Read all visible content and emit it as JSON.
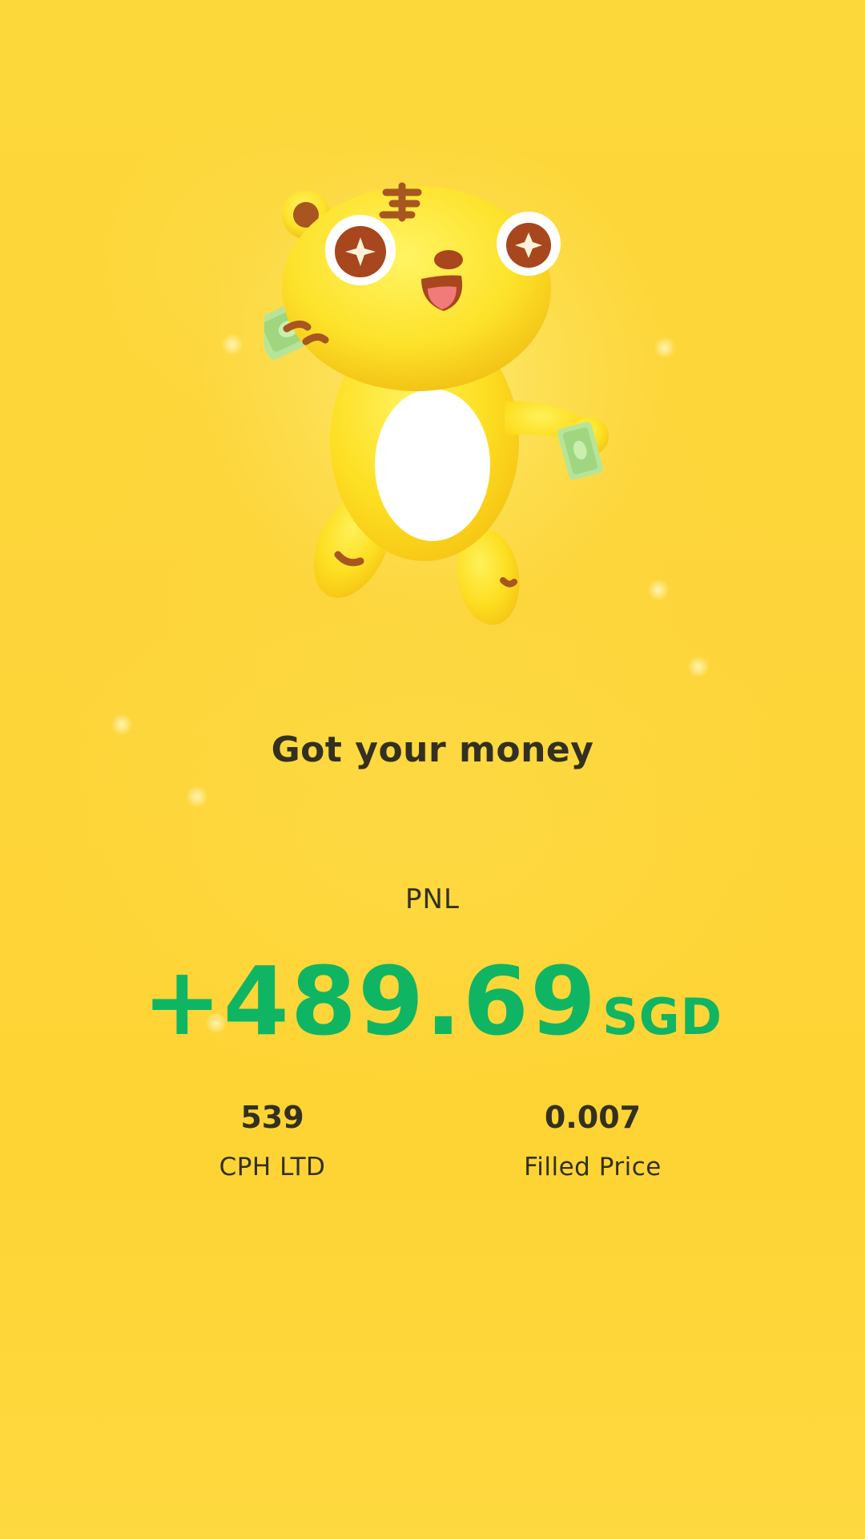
{
  "headline": "Got your money",
  "pnl": {
    "label": "PNL",
    "amount": "+489.69",
    "currency": "SGD",
    "color": "#0fb563"
  },
  "stats": [
    {
      "value": "539",
      "label": "CPH LTD"
    },
    {
      "value": "0.007",
      "label": "Filled Price"
    }
  ],
  "illustration": {
    "name": "tiger-mascot-with-cash",
    "colors": {
      "body": "#fde02a",
      "belly": "#ffffff",
      "stripes": "#a8561f",
      "cash": "#b6e59a"
    }
  }
}
